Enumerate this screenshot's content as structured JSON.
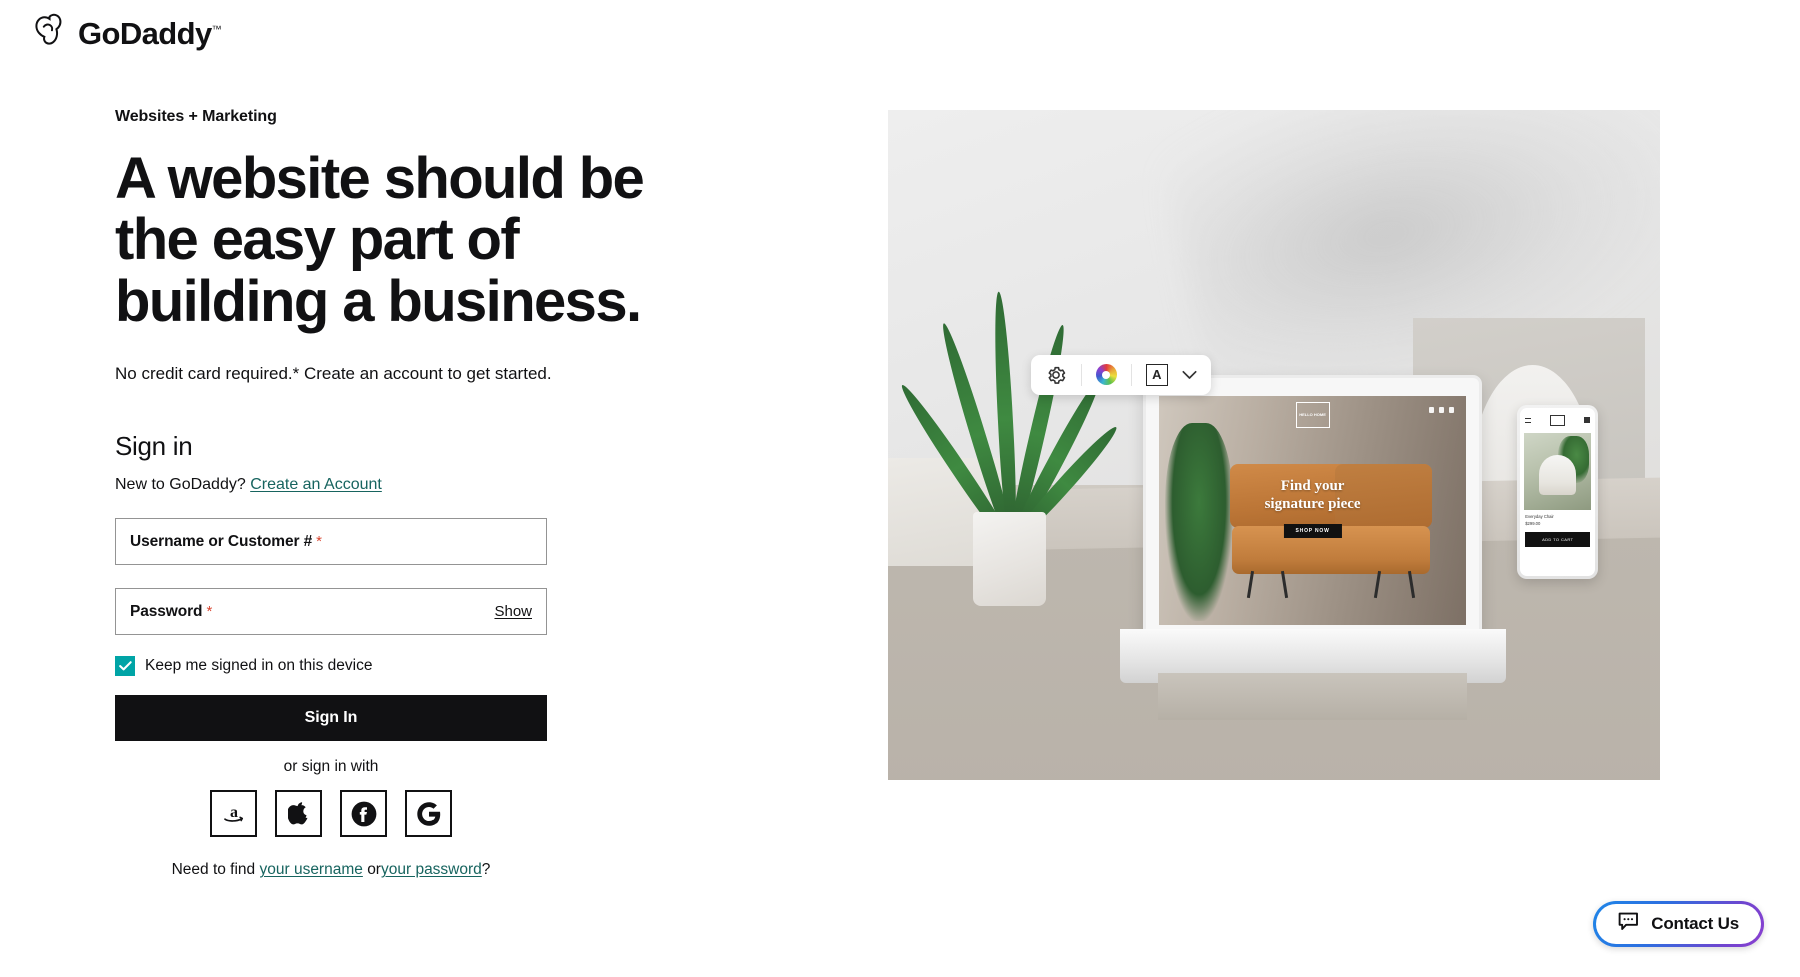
{
  "brand": {
    "name": "GoDaddy",
    "trademark": "™",
    "logo_icon": "godaddy-heart-logo"
  },
  "left": {
    "eyebrow": "Websites + Marketing",
    "headline": "A website should be the easy part of building a business.",
    "subhead": "No credit card required.* Create an account to get started.",
    "signin_heading": "Sign in",
    "new_prefix": "New to GoDaddy?",
    "create_account_link": "Create an Account"
  },
  "form": {
    "username": {
      "label": "Username or Customer #",
      "required_mark": "*",
      "value": "",
      "placeholder": ""
    },
    "password": {
      "label": "Password",
      "required_mark": "*",
      "value": "",
      "placeholder": "",
      "show_label": "Show"
    },
    "keep_signed_in": {
      "label": "Keep me signed in on this device",
      "checked": true
    },
    "submit_label": "Sign In",
    "or_sign_in_with": "or sign in with",
    "social": [
      {
        "name": "amazon",
        "icon": "amazon-icon"
      },
      {
        "name": "apple",
        "icon": "apple-icon"
      },
      {
        "name": "facebook",
        "icon": "facebook-icon"
      },
      {
        "name": "google",
        "icon": "google-icon"
      }
    ],
    "help": {
      "prefix": "Need to find",
      "username_link": "your username",
      "middle": "or",
      "password_link": "your password",
      "suffix": "?"
    }
  },
  "hero": {
    "alt": "Laptop and phone showing an online furniture store on a stone ledge",
    "toolbar": [
      {
        "name": "settings",
        "icon": "gear-icon"
      },
      {
        "name": "color",
        "icon": "color-wheel-icon"
      },
      {
        "name": "font",
        "icon": "letter-a-box-icon"
      },
      {
        "name": "more",
        "icon": "chevron-down-icon"
      }
    ],
    "laptop_site": {
      "logo_text": "HELLO\nHOME",
      "headline_line1": "Find your",
      "headline_line2": "signature piece",
      "cta": "SHOP NOW"
    },
    "phone_site": {
      "product_name": "Everyday Chair",
      "price": "$299.00",
      "cta": "ADD TO CART"
    }
  },
  "contact": {
    "label": "Contact Us",
    "icon": "chat-bubble-icon"
  },
  "colors": {
    "accent_teal": "#00a4a6",
    "link_teal": "#17645f",
    "required_red": "#d8442f",
    "button_black": "#111113",
    "contact_gradient_start": "#1f86e8",
    "contact_gradient_end": "#8b3fd0"
  }
}
